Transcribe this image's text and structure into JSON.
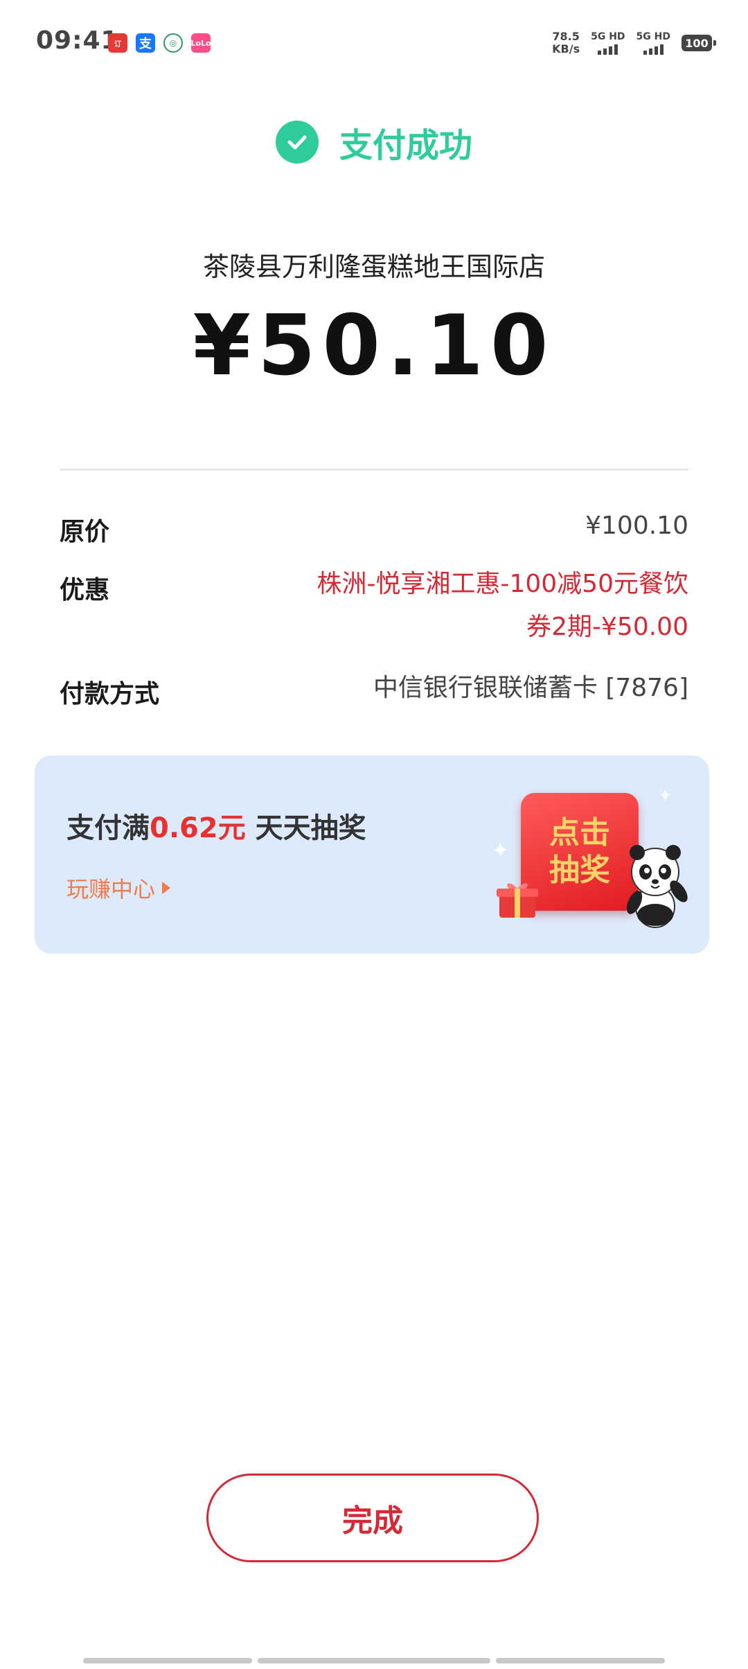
{
  "status_bar": {
    "time": "09:41",
    "notification_icons": [
      {
        "name": "app-notification-icon-1",
        "glyph": "订"
      },
      {
        "name": "alipay-notification-icon",
        "glyph": "支"
      },
      {
        "name": "app-notification-icon-3",
        "glyph": "◎"
      },
      {
        "name": "app-notification-icon-4",
        "glyph": "LoLo"
      }
    ],
    "net_speed_value": "78.5",
    "net_speed_unit": "KB/s",
    "sim1_label": "5G HD",
    "sim2_label": "5G HD",
    "battery": "100"
  },
  "header": {
    "status_text": "支付成功",
    "accent_color": "#2ecc9b"
  },
  "payment": {
    "merchant": "茶陵县万利隆蛋糕地王国际店",
    "amount": "¥50.10"
  },
  "details": {
    "original_price_label": "原价",
    "original_price_value": "¥100.10",
    "discount_label": "优惠",
    "discount_value": "株洲-悦享湘工惠-100减50元餐饮券2期-¥50.00",
    "method_label": "付款方式",
    "method_value": "中信银行银联储蓄卡 [7876]",
    "discount_color": "#d42a36"
  },
  "promo": {
    "title_prefix": "支付满",
    "title_amount": "0.62元",
    "title_suffix": " 天天抽奖",
    "link_text": "玩赚中心",
    "prize_button_text": "点击抽奖"
  },
  "footer": {
    "done_label": "完成"
  }
}
